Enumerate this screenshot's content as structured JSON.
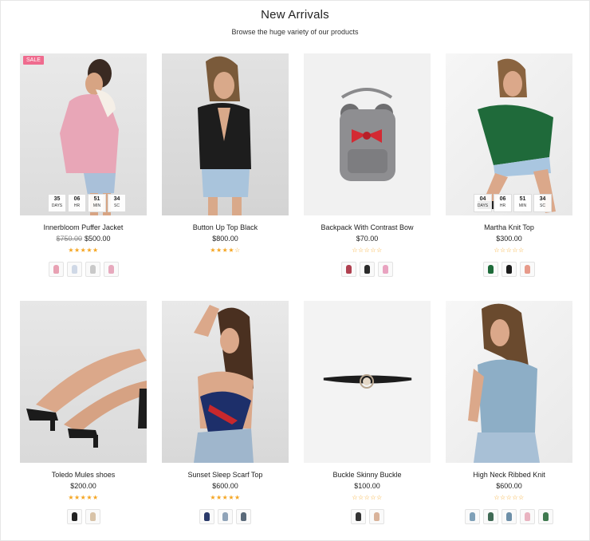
{
  "section": {
    "title": "New Arrivals",
    "subtitle": "Browse the huge variety of our products"
  },
  "products": [
    {
      "name": "Innerbloom Puffer Jacket",
      "old_price": "$750.00",
      "price": "$500.00",
      "badge": "SALE",
      "rating": 5,
      "countdown": [
        {
          "value": "35",
          "unit": "DAYS"
        },
        {
          "value": "06",
          "unit": "HR"
        },
        {
          "value": "51",
          "unit": "MIN"
        },
        {
          "value": "34",
          "unit": "SC"
        }
      ],
      "swatches": [
        "#e8a1b3",
        "#cfd8e6",
        "#c9c9c9",
        "#e7a9bd"
      ]
    },
    {
      "name": "Button Up Top Black",
      "price": "$800.00",
      "rating": 4,
      "swatches": []
    },
    {
      "name": "Backpack With Contrast Bow",
      "price": "$70.00",
      "rating": 0,
      "swatches": [
        "#b04050",
        "#2b2b2b",
        "#e9a3c0"
      ]
    },
    {
      "name": "Martha Knit Top",
      "price": "$300.00",
      "rating": 0,
      "countdown": [
        {
          "value": "04",
          "unit": "DAYS"
        },
        {
          "value": "06",
          "unit": "HR"
        },
        {
          "value": "51",
          "unit": "MIN"
        },
        {
          "value": "34",
          "unit": "SC"
        }
      ],
      "swatches": [
        "#1e6b3a",
        "#1c1c1c",
        "#e79a8a"
      ]
    },
    {
      "name": "Toledo Mules shoes",
      "price": "$200.00",
      "rating": 5,
      "swatches": [
        "#222222",
        "#d8c3a8"
      ]
    },
    {
      "name": "Sunset Sleep Scarf Top",
      "price": "$600.00",
      "rating": 5,
      "swatches": [
        "#2a3a6a",
        "#8fa3b8",
        "#5a6a7a"
      ]
    },
    {
      "name": "Buckle Skinny Buckle",
      "price": "$100.00",
      "rating": 0,
      "swatches": [
        "#333333",
        "#d9b39a"
      ]
    },
    {
      "name": "High Neck Ribbed Knit",
      "price": "$600.00",
      "rating": 0,
      "swatches": [
        "#7fa0b8",
        "#3f6a55",
        "#6d8fa8",
        "#e9b3c0",
        "#3f7a4f"
      ]
    }
  ]
}
